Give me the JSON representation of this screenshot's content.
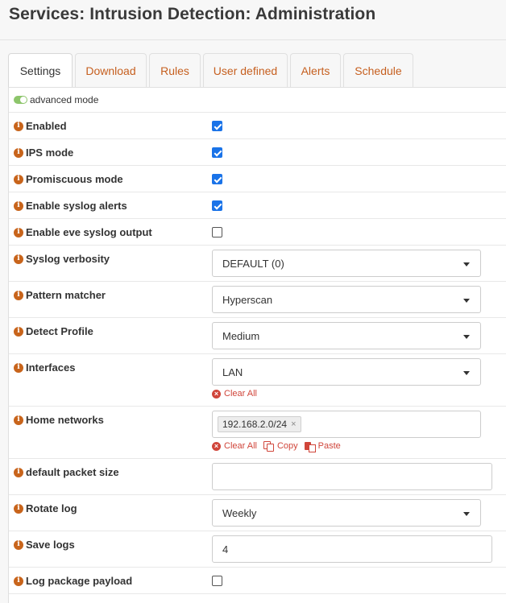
{
  "header": {
    "title": "Services: Intrusion Detection: Administration"
  },
  "tabs": [
    {
      "label": "Settings",
      "active": true
    },
    {
      "label": "Download",
      "active": false
    },
    {
      "label": "Rules",
      "active": false
    },
    {
      "label": "User defined",
      "active": false
    },
    {
      "label": "Alerts",
      "active": false
    },
    {
      "label": "Schedule",
      "active": false
    }
  ],
  "advanced_mode": {
    "label": "advanced mode",
    "on": true
  },
  "info_icon": "i",
  "fields": {
    "enabled": {
      "label": "Enabled",
      "checked": true
    },
    "ips_mode": {
      "label": "IPS mode",
      "checked": true
    },
    "promiscuous": {
      "label": "Promiscuous mode",
      "checked": true
    },
    "syslog_alerts": {
      "label": "Enable syslog alerts",
      "checked": true
    },
    "eve_syslog": {
      "label": "Enable eve syslog output",
      "checked": false
    },
    "syslog_verbosity": {
      "label": "Syslog verbosity",
      "value": "DEFAULT (0)"
    },
    "pattern_matcher": {
      "label": "Pattern matcher",
      "value": "Hyperscan"
    },
    "detect_profile": {
      "label": "Detect Profile",
      "value": "Medium"
    },
    "interfaces": {
      "label": "Interfaces",
      "value": "LAN",
      "clear_all": "Clear All"
    },
    "home_networks": {
      "label": "Home networks",
      "tag": "192.168.2.0/24",
      "tag_remove": "×",
      "clear_all": "Clear All",
      "copy": "Copy",
      "paste": "Paste"
    },
    "packet_size": {
      "label": "default packet size",
      "value": ""
    },
    "rotate_log": {
      "label": "Rotate log",
      "value": "Weekly"
    },
    "save_logs": {
      "label": "Save logs",
      "value": "4"
    },
    "log_payload": {
      "label": "Log package payload",
      "checked": false
    }
  },
  "colors": {
    "accent": "#c65f1f",
    "checkbox": "#1a73e8",
    "danger_link": "#d0453a",
    "toggle_on": "#8dc56b"
  }
}
